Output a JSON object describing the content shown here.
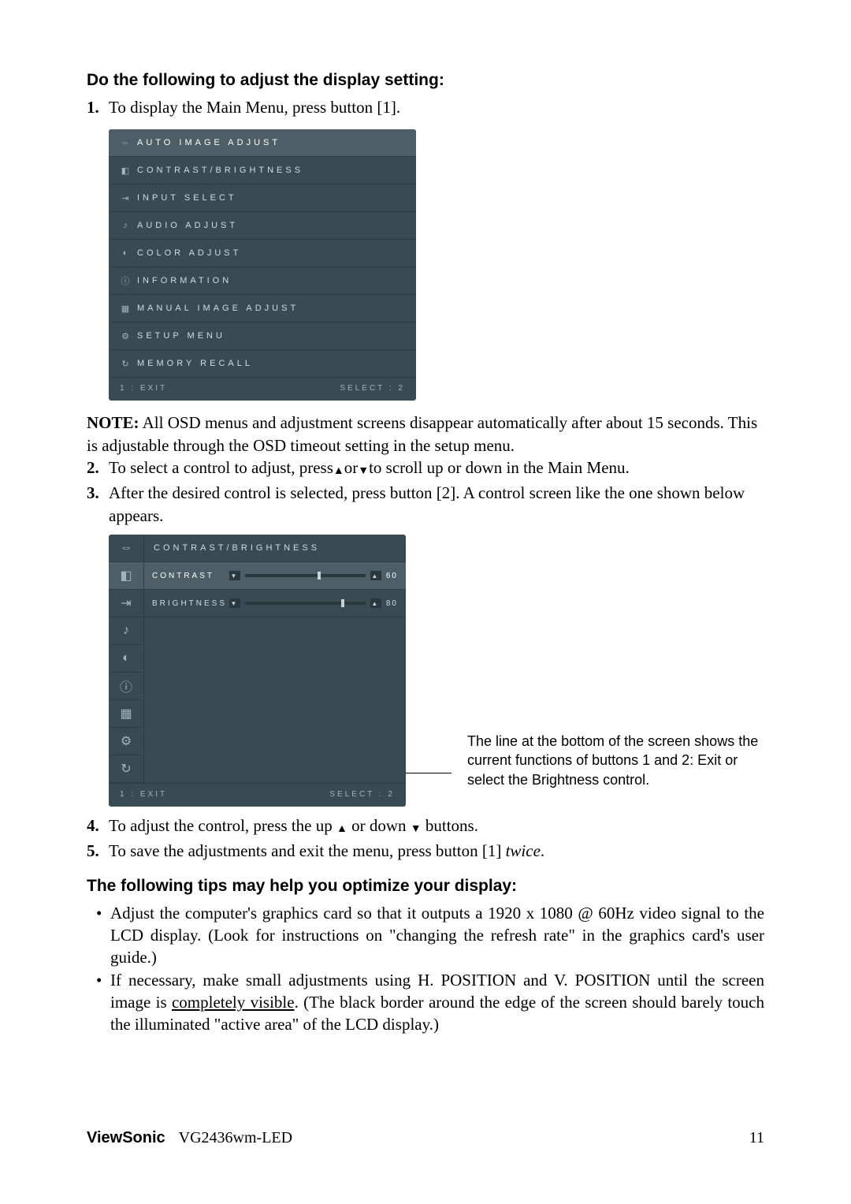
{
  "heading": "Do the following to adjust the display setting:",
  "step1_num": "1.",
  "step1_txt": "To display the Main Menu, press button [1].",
  "osd1": {
    "items": [
      {
        "label": "AUTO IMAGE ADJUST",
        "glyph": "⇔",
        "sel": true
      },
      {
        "label": "CONTRAST/BRIGHTNESS",
        "glyph": "◧",
        "sel": false
      },
      {
        "label": "INPUT SELECT",
        "glyph": "⇥",
        "sel": false
      },
      {
        "label": "AUDIO ADJUST",
        "glyph": "♪",
        "sel": false
      },
      {
        "label": "COLOR ADJUST",
        "glyph": "◐",
        "sel": false
      },
      {
        "label": "INFORMATION",
        "glyph": "ⓘ",
        "sel": false
      },
      {
        "label": "MANUAL IMAGE ADJUST",
        "glyph": "▦",
        "sel": false
      },
      {
        "label": "SETUP MENU",
        "glyph": "⚙",
        "sel": false
      },
      {
        "label": "MEMORY RECALL",
        "glyph": "↻",
        "sel": false
      }
    ],
    "foot_l": "1 : EXIT",
    "foot_r": "SELECT : 2"
  },
  "note_bold": "NOTE:",
  "note_txt": " All OSD menus and adjustment screens disappear automatically after about 15 seconds. This is adjustable through the OSD timeout setting in the setup menu.",
  "step2_num": "2.",
  "step2_pre": "To select a control to adjust, press",
  "step2_mid": "or",
  "step2_post": "to scroll up or down in the Main Menu.",
  "step3_num": "3.",
  "step3_txt": "After the desired control is selected, press button [2]. A control screen like the one shown below appears.",
  "osd2": {
    "title": "CONTRAST/BRIGHTNESS",
    "icons": [
      "⇔",
      "◧",
      "⇥",
      "♪",
      "◐",
      "ⓘ",
      "▦",
      "⚙",
      "↻"
    ],
    "controls": [
      {
        "label": "CONTRAST",
        "value": "60",
        "percent": 60,
        "sel": true
      },
      {
        "label": "BRIGHTNESS",
        "value": "80",
        "percent": 80,
        "sel": false
      }
    ],
    "foot_l": "1 : EXIT",
    "foot_r": "SELECT : 2"
  },
  "callout": "The line at the bottom of the screen shows the current functions of buttons 1 and 2: Exit or select the Brightness control.",
  "step4_num": "4.",
  "step4_pre": "To adjust the control, press the up ",
  "step4_mid": " or down ",
  "step4_post": " buttons.",
  "step5_num": "5.",
  "step5_pre": "To save the adjustments and exit the menu, press button [1] ",
  "step5_it": "twice",
  "step5_post": ".",
  "tips_heading": "The following tips may help you optimize your display:",
  "tip1": "Adjust the computer's graphics card so that it outputs a 1920 x 1080 @ 60Hz video signal to the LCD display. (Look for instructions on \"changing the refresh rate\" in the graphics card's user guide.)",
  "tip2_pre": "If necessary, make small adjustments using H. POSITION and V. POSITION until the screen image is ",
  "tip2_ul": "completely visible",
  "tip2_post": ". (The black border around the edge of the screen should barely touch the illuminated \"active area\" of the LCD display.)",
  "footer_brand": "ViewSonic",
  "footer_model": "VG2436wm-LED",
  "footer_page": "11"
}
